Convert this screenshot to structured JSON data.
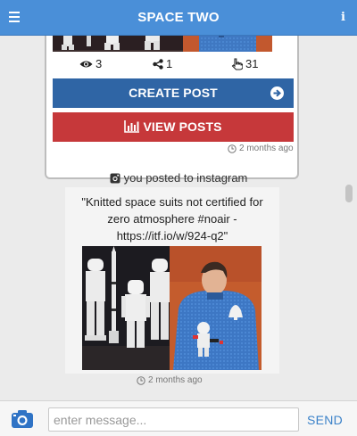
{
  "header": {
    "title": "SPACE TWO",
    "info_label": "i"
  },
  "top_card": {
    "stats": {
      "views": "3",
      "shares": "1",
      "likes": "31"
    },
    "create_label": "CREATE POST",
    "view_label": "VIEW POSTS",
    "timestamp": "2 months ago"
  },
  "instagram_post": {
    "action_text": "you posted to instagram",
    "caption": "\"Knitted space suits not certified for zero atmosphere #noair - https://itf.io/w/924-q2\"",
    "timestamp": "2 months ago"
  },
  "composer": {
    "placeholder": "enter message...",
    "send_label": "SEND"
  },
  "colors": {
    "header": "#4a8fd8",
    "create": "#2f65a5",
    "view": "#c6383a",
    "send": "#3b82c9"
  }
}
